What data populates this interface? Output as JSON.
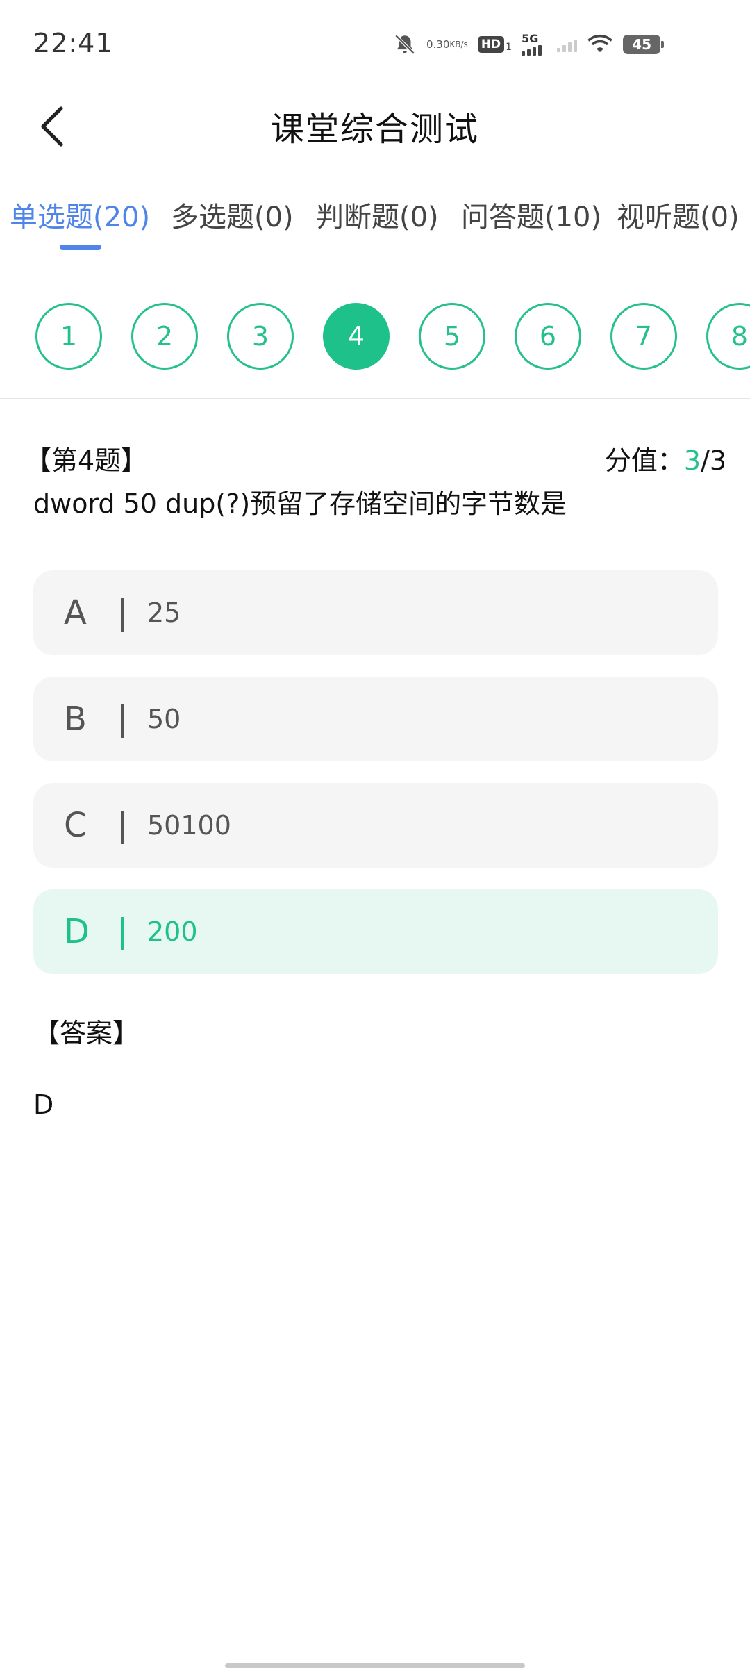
{
  "status_bar": {
    "time": "22:41",
    "net_speed_value": "0.30",
    "net_speed_unit": "KB/s",
    "hd_label": "HD",
    "hd_sub": "1",
    "network_label": "5G",
    "battery_level": "45",
    "icons": [
      "mute-bell-icon",
      "hd-icon",
      "cell-signal-icon",
      "cell-signal-2-icon",
      "wifi-icon",
      "battery-icon"
    ]
  },
  "header": {
    "title": "课堂综合测试",
    "back_icon": "chevron-left-icon"
  },
  "tabs": [
    {
      "label": "单选题(20)",
      "active": true
    },
    {
      "label": "多选题(0)",
      "active": false
    },
    {
      "label": "判断题(0)",
      "active": false
    },
    {
      "label": "问答题(10)",
      "active": false
    },
    {
      "label": "视听题(0)",
      "active": false
    }
  ],
  "question_numbers": [
    "1",
    "2",
    "3",
    "4",
    "5",
    "6",
    "7",
    "8"
  ],
  "active_question": "4",
  "question": {
    "header": "【第4题】",
    "score_label": "分值：",
    "score_obtained": "3",
    "score_total": "/3",
    "text": "dword 50 dup(?)预留了存储空间的字节数是"
  },
  "options": [
    {
      "letter": "A",
      "bar": "|",
      "value": "25",
      "selected": false
    },
    {
      "letter": "B",
      "bar": "|",
      "value": "50",
      "selected": false
    },
    {
      "letter": "C",
      "bar": "|",
      "value": "50100",
      "selected": false
    },
    {
      "letter": "D",
      "bar": "|",
      "value": "200",
      "selected": true
    }
  ],
  "answer": {
    "label": "【答案】",
    "value": "D"
  },
  "colors": {
    "accent_green": "#1ec189",
    "tab_blue": "#4f84e8",
    "selected_option_bg": "#e6f8f1",
    "option_bg": "#f5f5f5"
  }
}
